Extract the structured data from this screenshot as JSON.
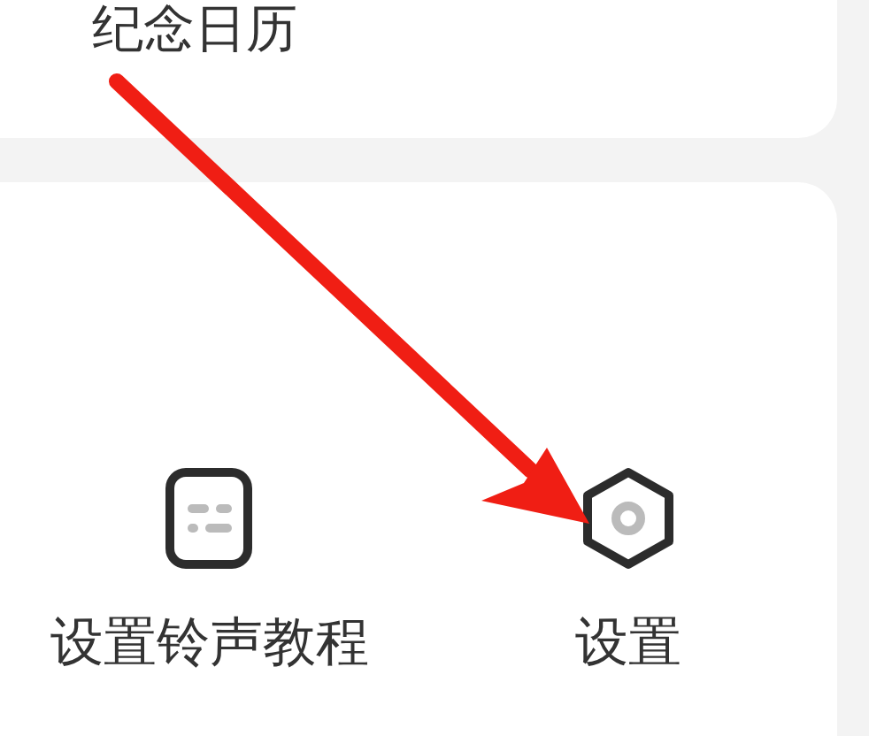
{
  "top_card": {
    "title": "纪念日历"
  },
  "tools": [
    {
      "kind": "tutorial",
      "label": "设置铃声教程"
    },
    {
      "kind": "settings",
      "label": "设置"
    }
  ]
}
